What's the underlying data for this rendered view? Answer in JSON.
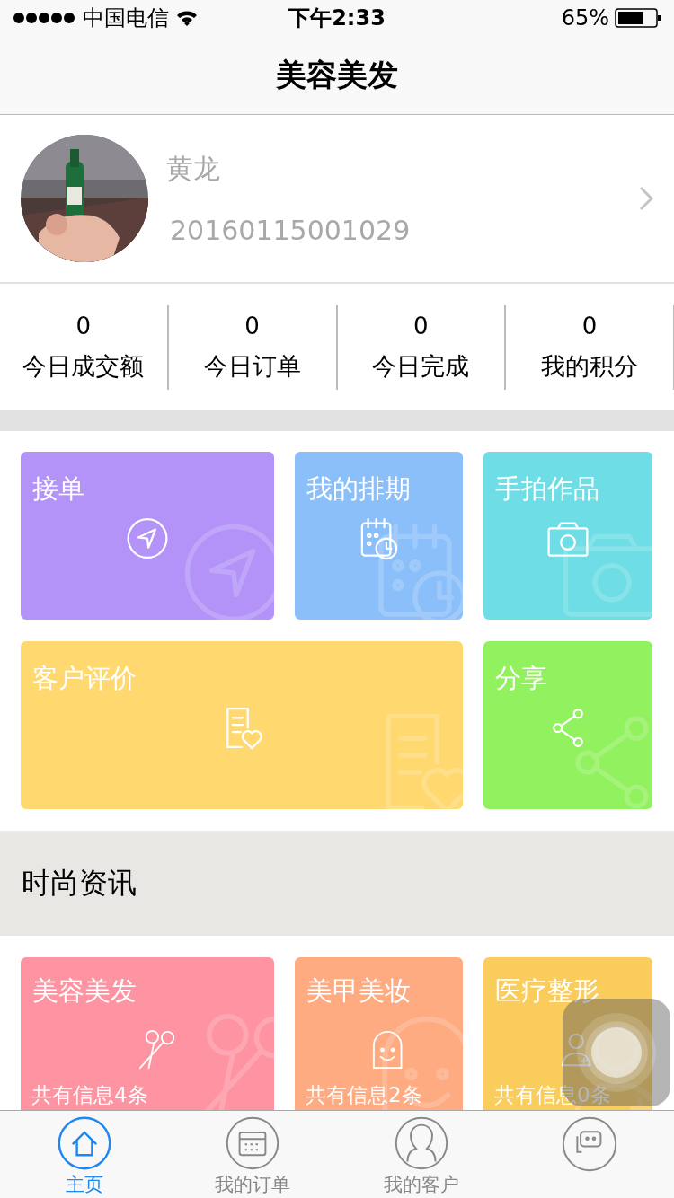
{
  "status_bar": {
    "carrier": "中国电信",
    "time": "下午2:33",
    "battery": "65%"
  },
  "nav": {
    "title": "美容美发"
  },
  "profile": {
    "name": "黄龙",
    "id": "20160115001029"
  },
  "stats": [
    {
      "value": "0",
      "label": "今日成交额"
    },
    {
      "value": "0",
      "label": "今日订单"
    },
    {
      "value": "0",
      "label": "今日完成"
    },
    {
      "value": "0",
      "label": "我的积分"
    }
  ],
  "tiles": [
    {
      "label": "接单",
      "kind": "navigate",
      "color": "#b393f8",
      "wide": false
    },
    {
      "label": "我的排期",
      "kind": "schedule",
      "color": "#8bbff9",
      "wide": false
    },
    {
      "label": "手拍作品",
      "kind": "camera",
      "color": "#6edde5",
      "wide": false
    },
    {
      "label": "客户评价",
      "kind": "review",
      "color": "#ffd970",
      "wide": true
    },
    {
      "label": "分享",
      "kind": "share",
      "color": "#92f15e",
      "wide": false
    }
  ],
  "section_title": "时尚资讯",
  "news": [
    {
      "title": "美容美发",
      "count": "共有信息4条",
      "kind": "scissors",
      "color": "#fe93a1"
    },
    {
      "title": "美甲美妆",
      "count": "共有信息2条",
      "kind": "face",
      "color": "#feab82"
    },
    {
      "title": "医疗整形",
      "count": "共有信息0条",
      "kind": "doctor",
      "color": "#f9cc5c"
    }
  ],
  "tabs": [
    {
      "label": "主页",
      "kind": "home",
      "selected": true
    },
    {
      "label": "我的订单",
      "kind": "orders",
      "selected": false
    },
    {
      "label": "我的客户",
      "kind": "customers",
      "selected": false
    },
    {
      "kind": "chat",
      "selected": false
    }
  ]
}
